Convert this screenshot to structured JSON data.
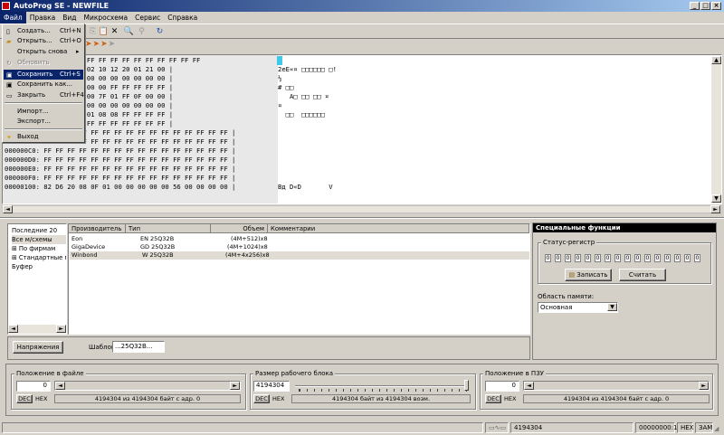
{
  "window": {
    "title": "AutoProg SE - NEWFILE"
  },
  "menubar": [
    "Файл",
    "Правка",
    "Вид",
    "Микросхема",
    "Сервис",
    "Справка"
  ],
  "file_menu": [
    {
      "label": "Создать...",
      "shortcut": "Ctrl+N",
      "icon": "new-file-icon"
    },
    {
      "label": "Открыть...",
      "shortcut": "Ctrl+O",
      "icon": "open-folder-icon"
    },
    {
      "label": "Открыть снова",
      "shortcut": "",
      "icon": "",
      "submenu": true
    },
    {
      "label": "Обновить",
      "shortcut": "",
      "icon": "refresh-icon",
      "disabled": true
    },
    {
      "label": "Сохранить",
      "shortcut": "Ctrl+S",
      "icon": "save-icon",
      "selected": true
    },
    {
      "label": "Сохранить как...",
      "shortcut": "",
      "icon": "save-as-icon"
    },
    {
      "label": "Закрыть",
      "shortcut": "Ctrl+F4",
      "icon": "close-file-icon"
    },
    {
      "label": "Импорт...",
      "shortcut": "",
      "icon": ""
    },
    {
      "label": "Экспорт...",
      "shortcut": "",
      "icon": ""
    },
    {
      "label": "Выход",
      "shortcut": "",
      "icon": "exit-icon"
    }
  ],
  "hex": {
    "rows": [
      {
        "hex": "   FF FF FF FF FF FF FF FF FF FF FF FF FF FF FF FF",
        "ascii": ""
      },
      {
        "hex": "   0F 03 00 04 02 06 02 10 12 20 01 21 00 |",
        "ascii": "2eE«¤ □□□□□□ □!"
      },
      {
        "hex": "   00 00 00 00 00 00 00 00 00 00 00 00 00 |",
        "ascii": "½"
      },
      {
        "hex": "   09 00 00 00 00 00 00 00 FF FF FF FF FF |",
        "ascii": "# □□"
      },
      {
        "hex": "   00 80 01 FF 03 01 00 7F 01 FF 0F 00 00 |",
        "ascii": "   A□ □□ □□ ¤"
      },
      {
        "hex": "   08 00 00 00 00 00 00 00 00 00 00 00 00 |",
        "ascii": "¤"
      },
      {
        "hex": "   0A 00 00 0D 0C 18 01 08 08 FF FF FF FF |",
        "ascii": "  □□  □□□□□□"
      },
      {
        "hex": "   FF FF FF FF FF FF FF FF FF FF FF FF FF |",
        "ascii": ""
      },
      {
        "hex": "000000A0: FF FF FF FF FF FF FF FF FF FF FF FF FF FF FF FF |",
        "ascii": ""
      },
      {
        "hex": "000000B0: FF FF FF FF FF FF FF FF FF FF FF FF FF FF FF FF |",
        "ascii": ""
      },
      {
        "hex": "000000C0: FF FF FF FF FF FF FF FF FF FF FF FF FF FF FF FF |",
        "ascii": ""
      },
      {
        "hex": "000000D0: FF FF FF FF FF FF FF FF FF FF FF FF FF FF FF FF |",
        "ascii": ""
      },
      {
        "hex": "000000E0: FF FF FF FF FF FF FF FF FF FF FF FF FF FF FF FF |",
        "ascii": ""
      },
      {
        "hex": "000000F0: FF FF FF FF FF FF FF FF FF FF FF FF FF FF FF FF |",
        "ascii": ""
      },
      {
        "hex": "00000100: 82 D6 20 08 0F 01 00 00 00 00 00 56 00 00 00 00 |",
        "ascii": "Bд D«D       V"
      }
    ]
  },
  "tree": [
    "Последние 20",
    "Все м/схемы",
    "По фирмам",
    "Стандартные м",
    "Буфер"
  ],
  "list": {
    "headers": [
      "Производитель",
      "Тип",
      "Объем",
      "Комментарии"
    ],
    "rows": [
      {
        "maker": "Eon",
        "type": "EN 25Q32B",
        "size": "(4M+512)x8"
      },
      {
        "maker": "GigaDevice",
        "type": "GD 25Q32B",
        "size": "(4M+1024)x8"
      },
      {
        "maker": "Winbond",
        "type": "W 25Q32B",
        "size": "(4M+4x256)x8"
      }
    ]
  },
  "voltage_button": "Напряжения",
  "template": {
    "label": "Шаблон",
    "value": "...25Q32B..."
  },
  "special": {
    "title": "Специальные функции",
    "status_register": "Статус-регистр",
    "bits": [
      "0",
      "0",
      "0",
      "0",
      "0",
      "0",
      "0",
      "0",
      "0",
      "0",
      "0",
      "0",
      "0",
      "0",
      "0",
      "0"
    ],
    "write": "Записать",
    "read": "Считать",
    "memory_area_label": "Область памяти:",
    "memory_area_value": "Основная"
  },
  "file_pos": {
    "title": "Положение в файле",
    "value": "0",
    "dec": "DEC",
    "hex": "HEX",
    "info": "4194304 из 4194304 байт с адр. 0"
  },
  "block_size": {
    "title": "Размер рабочего блока",
    "value": "4194304",
    "dec": "DEC",
    "hex": "HEX",
    "info": "4194304 байт из 4194304 возм."
  },
  "rom_pos": {
    "title": "Положение в ПЗУ",
    "value": "0",
    "dec": "DEC",
    "hex": "HEX",
    "info": "4194304 из 4194304 байт с адр. 0"
  },
  "statusbar": {
    "size": "4194304",
    "addr": "00000000:1",
    "mode": "HEX",
    "ins": "ЗАМ"
  }
}
